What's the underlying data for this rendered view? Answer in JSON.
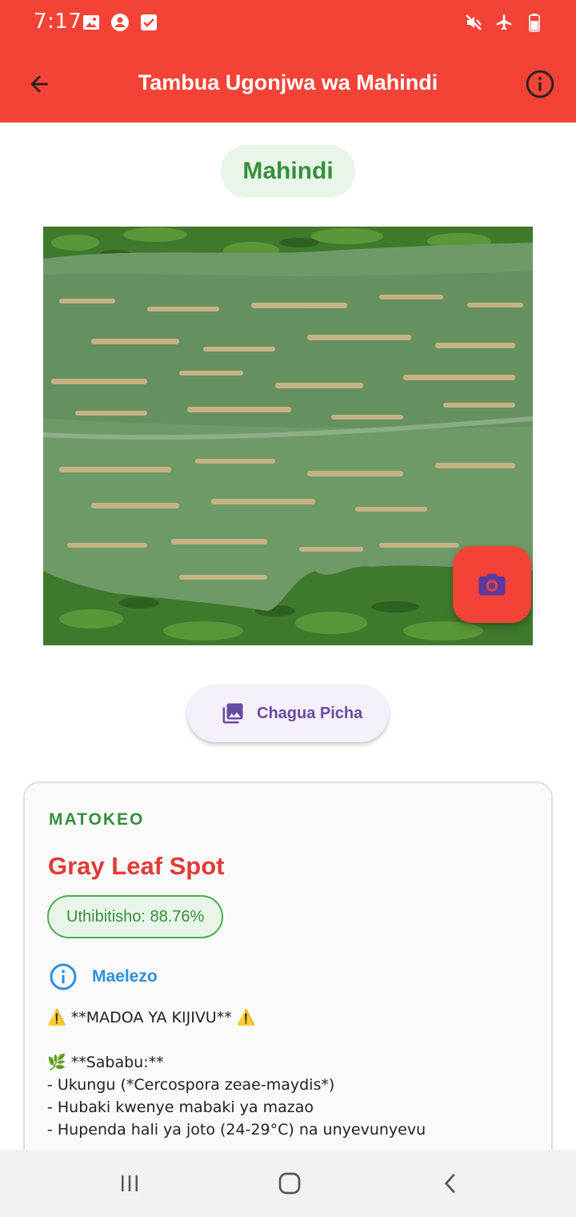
{
  "status_bar": {
    "time": "7:17",
    "left_icons": [
      "gallery-icon",
      "account-circle-icon",
      "check-box-icon"
    ],
    "right_icons": [
      "mute-icon",
      "airplane-icon",
      "battery-icon"
    ]
  },
  "app_bar": {
    "title": "Tambua Ugonjwa wa Mahindi",
    "back_icon": "arrow-back-icon",
    "info_icon": "info-icon",
    "background": "#f44336"
  },
  "crop_chip": {
    "label": "Mahindi"
  },
  "photo": {
    "subject": "maize leaf with gray leaf spot lesions"
  },
  "camera_fab": {
    "icon": "camera-icon"
  },
  "pick_button": {
    "label": "Chagua Picha",
    "icon": "photo-library-icon"
  },
  "result": {
    "heading": "MATOKEO",
    "disease": "Gray Leaf Spot",
    "confidence": "Uthibitisho: 88.76%",
    "description_label": "Maelezo",
    "description_lines": [
      "⚠️ **MADOA YA KIJIVU** ⚠️",
      "",
      "🌿 **Sababu:**",
      "- Ukungu (*Cercospora zeae-maydis*)",
      "- Hubaki kwenye mabaki ya mazao",
      "- Hupenda hali ya joto (24-29°C) na unyevunyevu"
    ]
  },
  "nav_bar": {
    "buttons": [
      "recent-apps-icon",
      "home-icon",
      "back-icon"
    ]
  },
  "colors": {
    "accent_red": "#f44336",
    "disease_red": "#e53935",
    "success_green": "#388e3c",
    "info_blue": "#2f8fdc",
    "purple": "#6a4ba3"
  }
}
